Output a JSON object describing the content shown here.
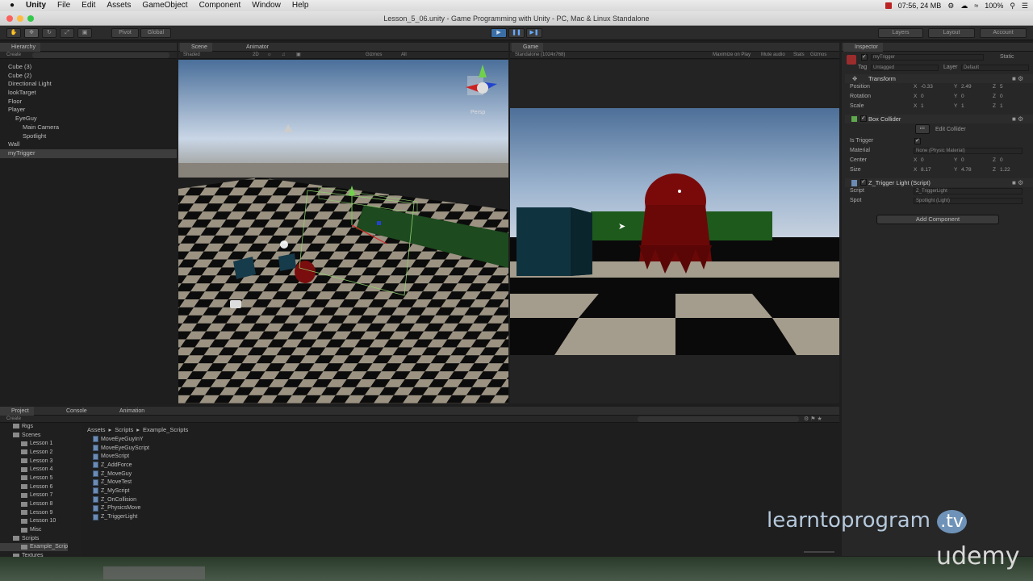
{
  "menubar": {
    "app": "Unity",
    "items": [
      "File",
      "Edit",
      "Assets",
      "GameObject",
      "Component",
      "Window",
      "Help"
    ],
    "status": "07:56, 24 MB",
    "battery": "100%"
  },
  "window_title": "Lesson_5_06.unity - Game Programming with Unity - PC, Mac & Linux Standalone",
  "toolbar": {
    "pivot": "Pivot",
    "global": "Global",
    "layers": "Layers",
    "layout": "Layout",
    "account": "Account"
  },
  "hierarchy": {
    "tab": "Hierarchy",
    "create": "Create",
    "items": [
      {
        "label": "Cube (3)",
        "indent": 0,
        "selected": false
      },
      {
        "label": "Cube (2)",
        "indent": 0,
        "selected": false
      },
      {
        "label": "Directional Light",
        "indent": 0,
        "selected": false
      },
      {
        "label": "lookTarget",
        "indent": 0,
        "selected": false
      },
      {
        "label": "Floor",
        "indent": 0,
        "selected": false
      },
      {
        "label": "Player",
        "indent": 0,
        "selected": false
      },
      {
        "label": "EyeGuy",
        "indent": 1,
        "selected": false
      },
      {
        "label": "Main Camera",
        "indent": 2,
        "selected": false
      },
      {
        "label": "Spotlight",
        "indent": 2,
        "selected": false
      },
      {
        "label": "Wall",
        "indent": 0,
        "selected": false
      },
      {
        "label": "myTrigger",
        "indent": 0,
        "selected": true
      }
    ]
  },
  "scene": {
    "tab": "Scene",
    "tab2": "Animator",
    "shading": "Shaded",
    "mode2d": "2D",
    "gizmos": "Gizmos",
    "all": "All",
    "persp": "Persp"
  },
  "game": {
    "tab": "Game",
    "resolution": "Standalone (1024x768)",
    "maximize": "Maximize on Play",
    "mute": "Mute audio",
    "stats": "Stats",
    "gizmos": "Gizmos"
  },
  "inspector": {
    "tab": "Inspector",
    "object_name": "myTrigger",
    "static": "Static",
    "tag_label": "Tag",
    "tag_value": "Untagged",
    "layer_label": "Layer",
    "layer_value": "Default",
    "transform": {
      "title": "Transform",
      "position": {
        "label": "Position",
        "x": "-0.33",
        "y": "2.49",
        "z": "5"
      },
      "rotation": {
        "label": "Rotation",
        "x": "0",
        "y": "0",
        "z": "0"
      },
      "scale": {
        "label": "Scale",
        "x": "1",
        "y": "1",
        "z": "1"
      }
    },
    "box_collider": {
      "title": "Box Collider",
      "edit": "Edit Collider",
      "is_trigger_label": "Is Trigger",
      "is_trigger": "✓",
      "material_label": "Material",
      "material": "None (Physic Material)",
      "center": {
        "label": "Center",
        "x": "0",
        "y": "0",
        "z": "0"
      },
      "size": {
        "label": "Size",
        "x": "8.17",
        "y": "4.78",
        "z": "1.22"
      }
    },
    "script_comp": {
      "title": "Z_Trigger Light (Script)",
      "script_label": "Script",
      "script_value": "Z_TriggerLight",
      "spot_label": "Spot",
      "spot_value": "Spotlight (Light)"
    },
    "add_component": "Add Component"
  },
  "project": {
    "tab": "Project",
    "console": "Console",
    "animation": "Animation",
    "create": "Create",
    "breadcrumb": [
      "Assets",
      "Scripts",
      "Example_Scripts"
    ],
    "tree": [
      {
        "label": "Rigs",
        "indent": 1
      },
      {
        "label": "Scenes",
        "indent": 1
      },
      {
        "label": "Lesson 1",
        "indent": 2
      },
      {
        "label": "Lesson 2",
        "indent": 2
      },
      {
        "label": "Lesson 3",
        "indent": 2
      },
      {
        "label": "Lesson 4",
        "indent": 2
      },
      {
        "label": "Lesson 5",
        "indent": 2
      },
      {
        "label": "Lesson 6",
        "indent": 2
      },
      {
        "label": "Lesson 7",
        "indent": 2
      },
      {
        "label": "Lesson 8",
        "indent": 2
      },
      {
        "label": "Lesson 9",
        "indent": 2
      },
      {
        "label": "Lesson 10",
        "indent": 2
      },
      {
        "label": "Misc",
        "indent": 2
      },
      {
        "label": "Scripts",
        "indent": 1
      },
      {
        "label": "Example_Scrip",
        "indent": 2
      },
      {
        "label": "Textures",
        "indent": 1
      }
    ],
    "files": [
      "MoveEyeGuyInY",
      "MoveEyeGuyScript",
      "MoveScript",
      "Z_AddForce",
      "Z_MoveGuy",
      "Z_MoveTest",
      "Z_MyScript",
      "Z_OnCollision",
      "Z_PhysicsMove",
      "Z_TriggerLight"
    ]
  },
  "watermark": {
    "brand1a": "learntoprogram",
    "brand1b": ".tv",
    "brand2": "udemy"
  }
}
